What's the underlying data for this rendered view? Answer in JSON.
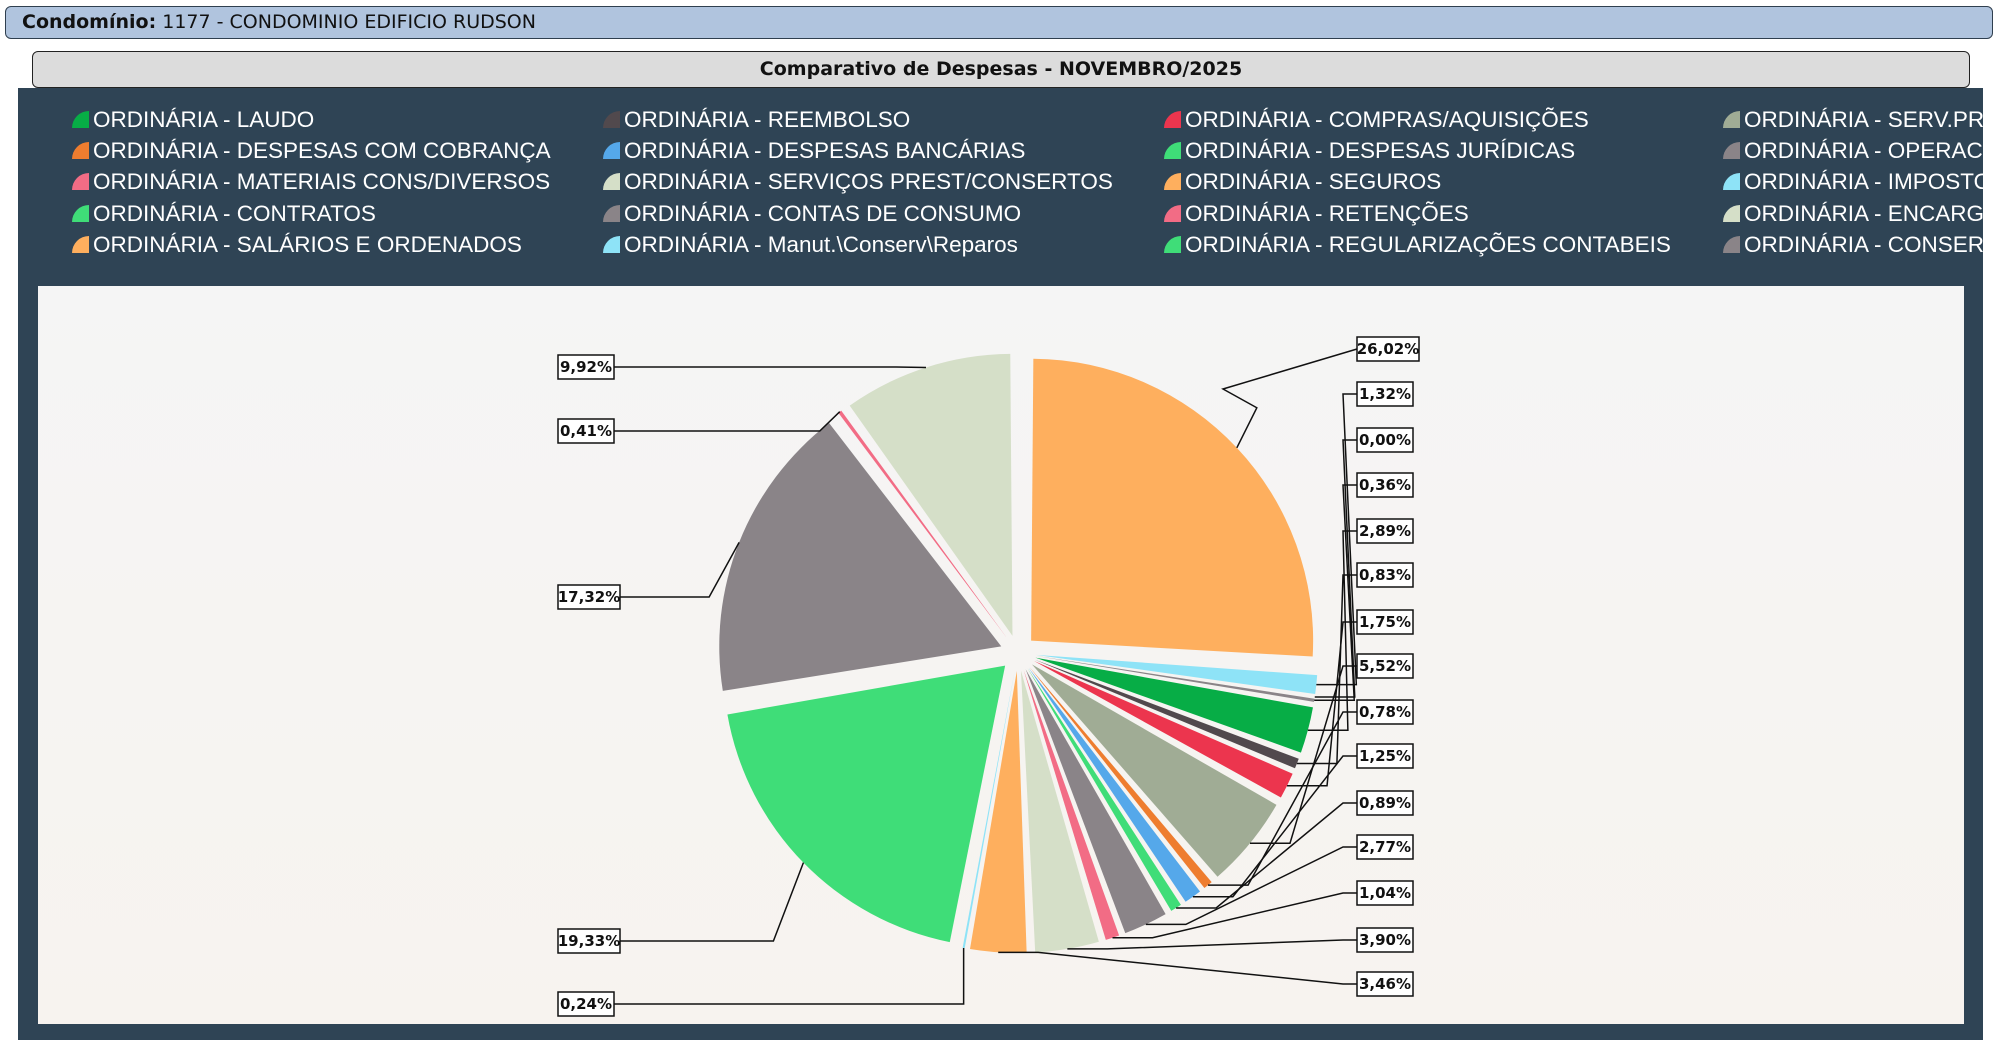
{
  "header": {
    "condo_label": "Condomínio:",
    "condo_value": "1177 - CONDOMINIO EDIFICIO RUDSON"
  },
  "chart_title": "Comparativo de Despesas - NOVEMBRO/2025",
  "legend": [
    {
      "label": "ORDINÁRIA - LAUDO",
      "color": "#07ad46"
    },
    {
      "label": "ORDINÁRIA - DESPESAS COM COBRANÇA",
      "color": "#ee7d2f"
    },
    {
      "label": "ORDINÁRIA - MATERIAIS CONS/DIVERSOS",
      "color": "#f26c85"
    },
    {
      "label": "ORDINÁRIA - CONTRATOS",
      "color": "#3fdd78"
    },
    {
      "label": "ORDINÁRIA - SALÁRIOS E ORDENADOS",
      "color": "#feaf5e"
    },
    {
      "label": "ORDINÁRIA - REEMBOLSO",
      "color": "#51494d"
    },
    {
      "label": "ORDINÁRIA - DESPESAS BANCÁRIAS",
      "color": "#55a8ea"
    },
    {
      "label": "ORDINÁRIA - SERVIÇOS PREST/CONSERTOS",
      "color": "#d5dfc8"
    },
    {
      "label": "ORDINÁRIA - CONTAS DE CONSUMO",
      "color": "#8a8488"
    },
    {
      "label": "ORDINÁRIA - Manut.\\Conserv\\Reparos",
      "color": "#8ee3f7"
    },
    {
      "label": "ORDINÁRIA - COMPRAS/AQUISIÇÕES",
      "color": "#ec354e"
    },
    {
      "label": "ORDINÁRIA - DESPESAS JURÍDICAS",
      "color": "#3fdd78"
    },
    {
      "label": "ORDINÁRIA - SEGUROS",
      "color": "#feaf5e"
    },
    {
      "label": "ORDINÁRIA - RETENÇÕES",
      "color": "#f26c85"
    },
    {
      "label": "ORDINÁRIA - REGULARIZAÇÕES CONTABEIS",
      "color": "#3fdd78"
    },
    {
      "label": "ORDINÁRIA - SERV.PR",
      "color": "#a0ac95"
    },
    {
      "label": "ORDINÁRIA - OPERAC",
      "color": "#8a8488"
    },
    {
      "label": "ORDINÁRIA - IMPOSTO",
      "color": "#8ee3f7"
    },
    {
      "label": "ORDINÁRIA - ENCARG",
      "color": "#d5dfc8"
    },
    {
      "label": "ORDINÁRIA - CONSER",
      "color": "#8a8488"
    }
  ],
  "chart_data": {
    "type": "pie",
    "title": "Comparativo de Despesas - NOVEMBRO/2025",
    "slices": [
      {
        "label": "26,02%",
        "value": 26.02,
        "color": "#feaf5e"
      },
      {
        "label": "1,32%",
        "value": 1.32,
        "color": "#8ee3f7"
      },
      {
        "label": "0,00%",
        "value": 0.0,
        "color": "#d5dfc8"
      },
      {
        "label": "0,36%",
        "value": 0.36,
        "color": "#8a8488"
      },
      {
        "label": "2,89%",
        "value": 2.89,
        "color": "#07ad46"
      },
      {
        "label": "0,83%",
        "value": 0.83,
        "color": "#51494d"
      },
      {
        "label": "1,75%",
        "value": 1.75,
        "color": "#ec354e"
      },
      {
        "label": "5,52%",
        "value": 5.52,
        "color": "#a0ac95"
      },
      {
        "label": "0,78%",
        "value": 0.78,
        "color": "#ee7d2f"
      },
      {
        "label": "1,25%",
        "value": 1.25,
        "color": "#55a8ea"
      },
      {
        "label": "0,89%",
        "value": 0.89,
        "color": "#3fdd78"
      },
      {
        "label": "2,77%",
        "value": 2.77,
        "color": "#8a8488"
      },
      {
        "label": "1,04%",
        "value": 1.04,
        "color": "#f26c85"
      },
      {
        "label": "3,90%",
        "value": 3.9,
        "color": "#d5dfc8"
      },
      {
        "label": "3,46%",
        "value": 3.46,
        "color": "#feaf5e"
      },
      {
        "label": "0,24%",
        "value": 0.24,
        "color": "#8ee3f7"
      },
      {
        "label": "19,33%",
        "value": 19.33,
        "color": "#3fdd78"
      },
      {
        "label": "17,32%",
        "value": 17.32,
        "color": "#8a8488"
      },
      {
        "label": "0,41%",
        "value": 0.41,
        "color": "#f26c85"
      },
      {
        "label": "9,92%",
        "value": 9.92,
        "color": "#d5dfc8"
      }
    ]
  }
}
